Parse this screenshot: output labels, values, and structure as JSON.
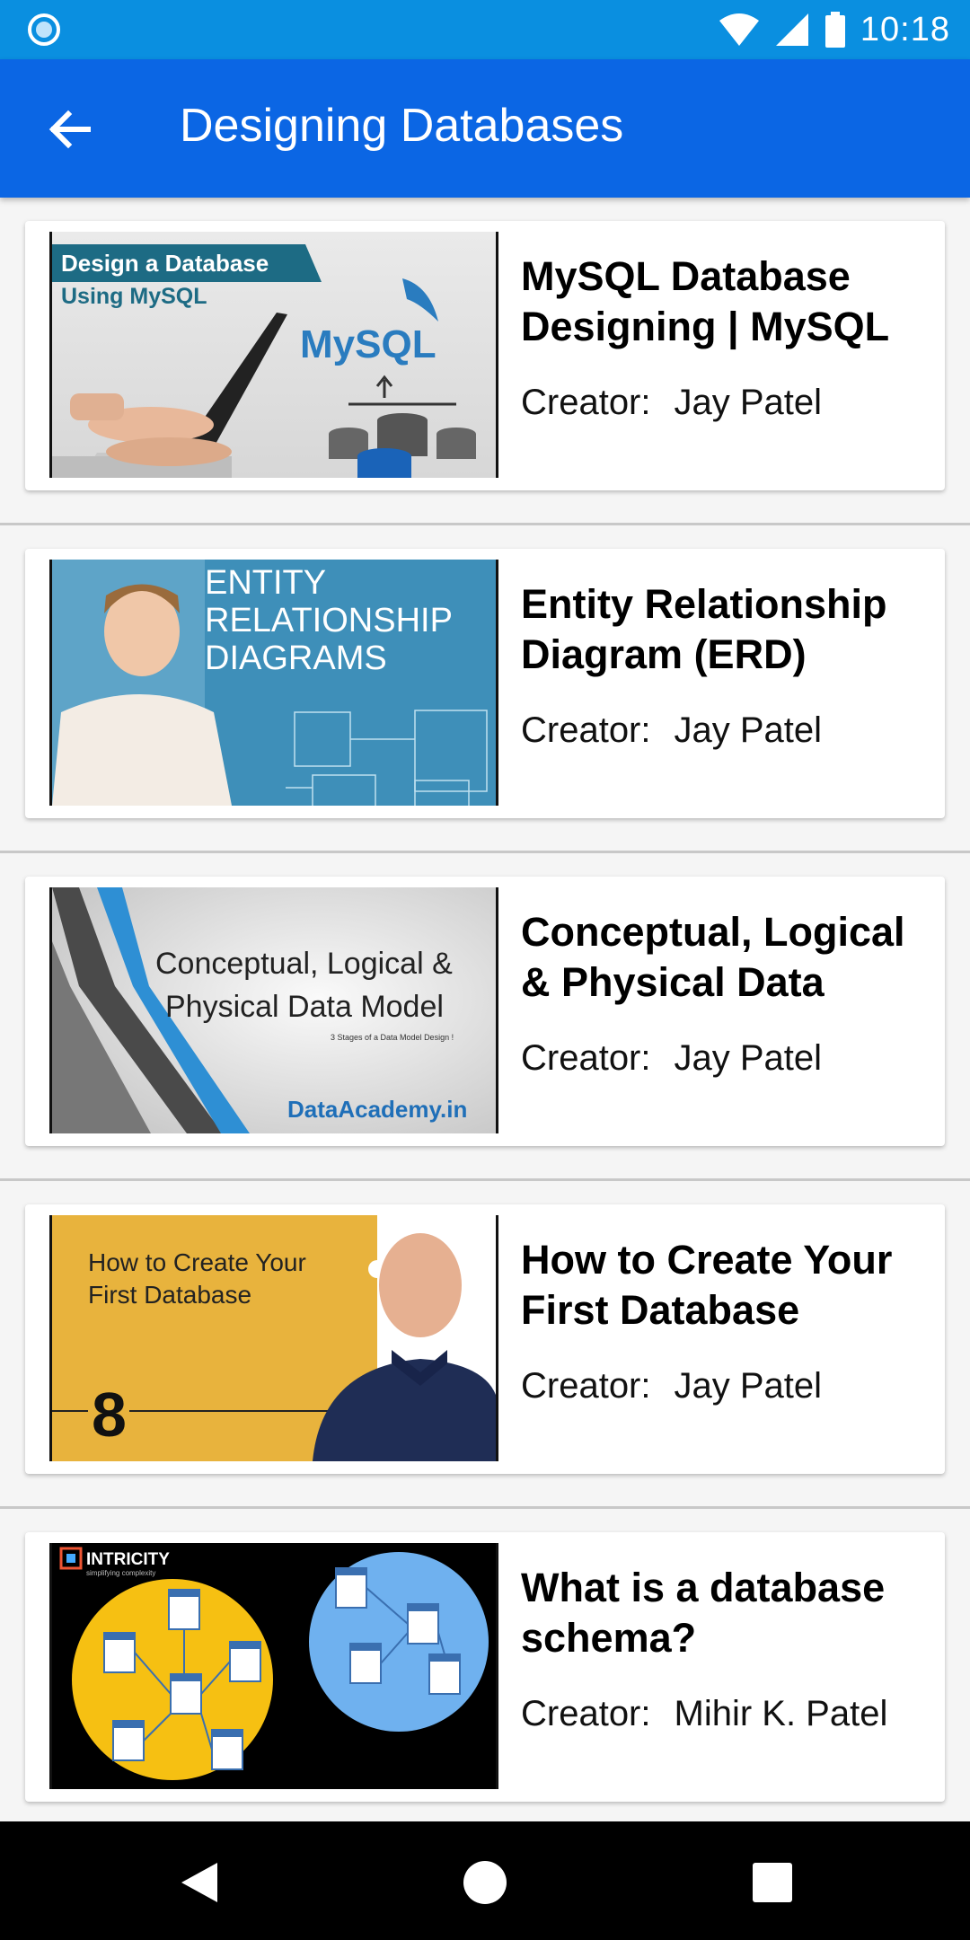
{
  "status_bar": {
    "time": "10:18"
  },
  "app_bar": {
    "title": "Designing Databases"
  },
  "courses": [
    {
      "title": "MySQL Database Designing | MySQL",
      "creator_label": "Creator:",
      "creator": "Jay Patel",
      "thumb": {
        "line1": "Design a Database",
        "line2": "Using MySQL",
        "brand": "MySQL"
      }
    },
    {
      "title": "Entity Relationship Diagram (ERD)",
      "creator_label": "Creator:",
      "creator": "Jay Patel",
      "thumb": {
        "line1": "ENTITY",
        "line2": "RELATIONSHIP",
        "line3": "DIAGRAMS"
      }
    },
    {
      "title": "Conceptual, Logical & Physical Data",
      "creator_label": "Creator:",
      "creator": "Jay Patel",
      "thumb": {
        "line1": "Conceptual, Logical &",
        "line2": "Physical Data Model",
        "line3": "3 Stages of a Data Model Design !",
        "brand": "DataAcademy.in"
      }
    },
    {
      "title": "How to Create Your First Database",
      "creator_label": "Creator:",
      "creator": "Jay Patel",
      "thumb": {
        "line1": "How to Create Your",
        "line2": "First Database",
        "number": "8"
      }
    },
    {
      "title": "What is a database schema?",
      "creator_label": "Creator:",
      "creator": "Mihir K. Patel",
      "thumb": {
        "brand": "INTRICITY",
        "tagline": "simplifying complexity"
      }
    }
  ]
}
